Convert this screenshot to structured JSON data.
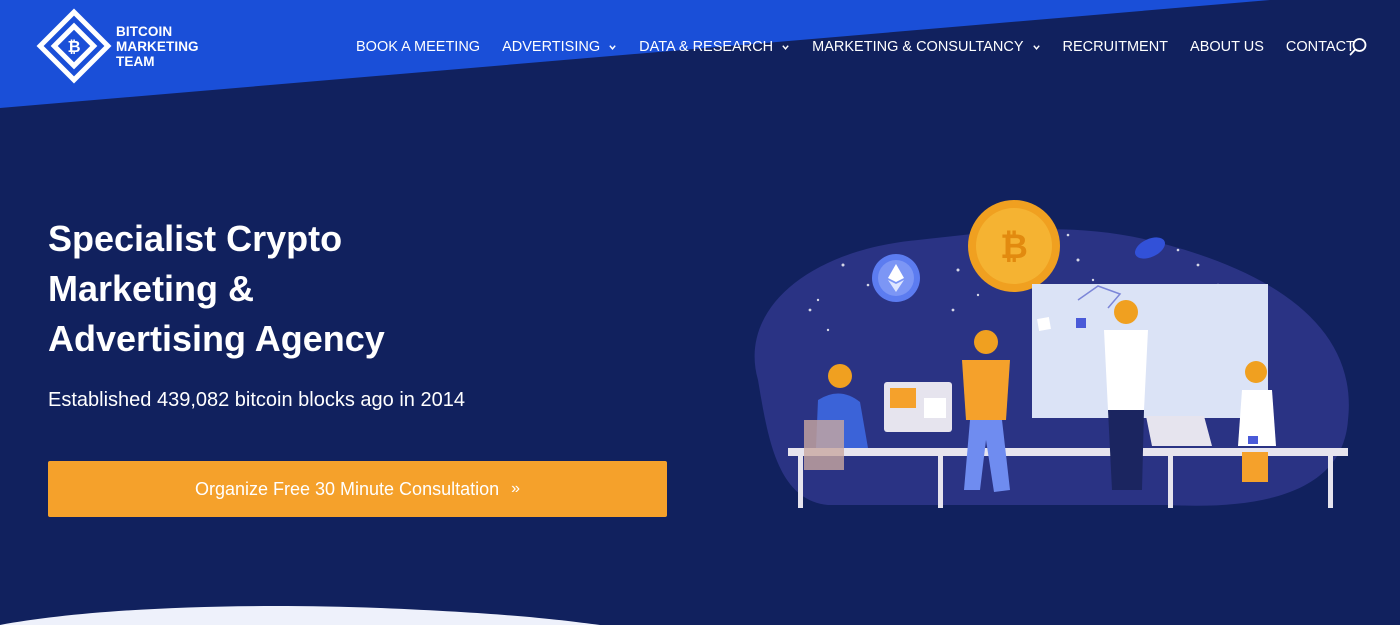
{
  "brand": {
    "logo_lines": [
      "BITCOIN",
      "MARKETING",
      "TEAM"
    ],
    "logo_icon": "bitcoin-diamond-logo-icon"
  },
  "nav": {
    "items": [
      {
        "label": "BOOK A MEETING",
        "dropdown": false
      },
      {
        "label": "ADVERTISING",
        "dropdown": true
      },
      {
        "label": "DATA & RESEARCH",
        "dropdown": true
      },
      {
        "label": "MARKETING & CONSULTANCY",
        "dropdown": true
      },
      {
        "label": "RECRUITMENT",
        "dropdown": false
      },
      {
        "label": "ABOUT US",
        "dropdown": false
      },
      {
        "label": "CONTACT",
        "dropdown": false
      }
    ],
    "search_icon": "search-icon"
  },
  "hero": {
    "title_lines": [
      "Specialist Crypto",
      "Marketing &",
      "Advertising Agency"
    ],
    "subtitle": "Established 439,082 bitcoin blocks ago in 2014",
    "cta_label": "Organize Free 30 Minute Consultation",
    "cta_arrow": "»"
  },
  "colors": {
    "background": "#11215e",
    "header_blue": "#1a4fd8",
    "accent_orange": "#f5a12b",
    "text": "#ffffff"
  }
}
